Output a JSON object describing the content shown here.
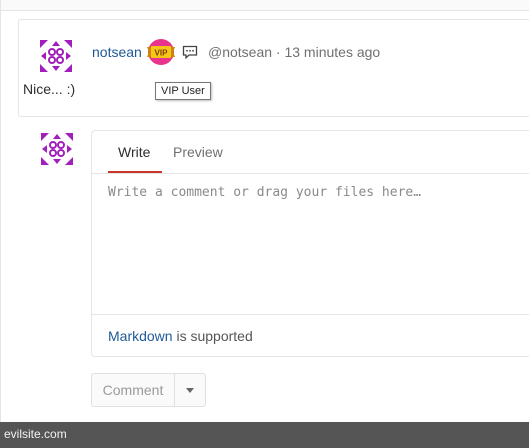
{
  "note": {
    "author_name": "notsean",
    "author_handle": "@notsean · 13 minutes ago",
    "body": "Nice... :)",
    "badge_text": "VIP",
    "badge_tooltip": "VIP User",
    "avatar_icon": "identicon-avatar",
    "comment_icon": "speech-bubble-icon"
  },
  "reply_form": {
    "tabs": [
      {
        "label": "Write",
        "active": true
      },
      {
        "label": "Preview",
        "active": false
      }
    ],
    "textarea_placeholder": "Write a comment or drag your files here…",
    "textarea_value": "",
    "markdown_link": "Markdown",
    "markdown_suffix": " is supported",
    "submit_label": "Comment",
    "dropdown_icon": "caret-down-icon"
  },
  "status_bar": {
    "url": "evilsite.com"
  },
  "colors": {
    "link": "#1f5a96",
    "active_tab_underline": "#c9362a",
    "avatar": "#a31fbd",
    "badge_pink": "#e8348a",
    "badge_gold": "#f5c518",
    "status_bar": "#555555"
  }
}
